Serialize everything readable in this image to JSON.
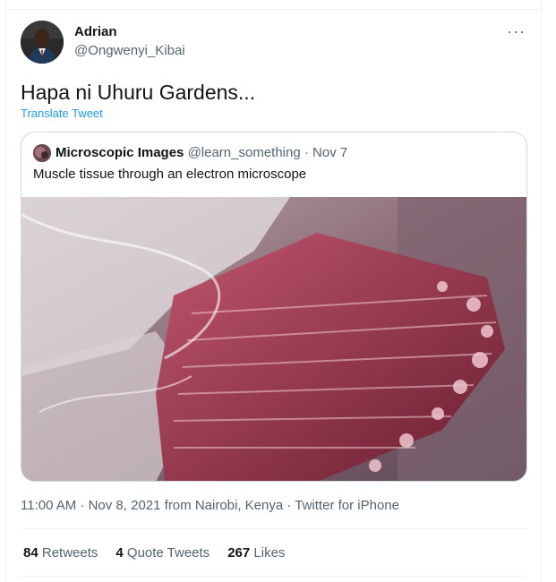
{
  "author": {
    "name": "Adrian",
    "handle": "@Ongwenyi_Kibai"
  },
  "more_label": "···",
  "tweet": {
    "text": "Hapa ni Uhuru Gardens...",
    "translate_label": "Translate Tweet"
  },
  "quoted": {
    "name": "Microscopic Images",
    "handle": "@learn_something",
    "separator": "·",
    "date": "Nov 7",
    "text": "Muscle tissue through an electron microscope"
  },
  "meta": {
    "timestamp": "11:00 AM · Nov 8, 2021 from Nairobi, Kenya · Twitter for iPhone"
  },
  "stats": {
    "retweets_count": "84",
    "retweets_label": "Retweets",
    "quotes_count": "4",
    "quotes_label": "Quote Tweets",
    "likes_count": "267",
    "likes_label": "Likes"
  },
  "colors": {
    "link": "#1d9bf0",
    "secondary_text": "#536471",
    "border": "#cfd9de"
  }
}
